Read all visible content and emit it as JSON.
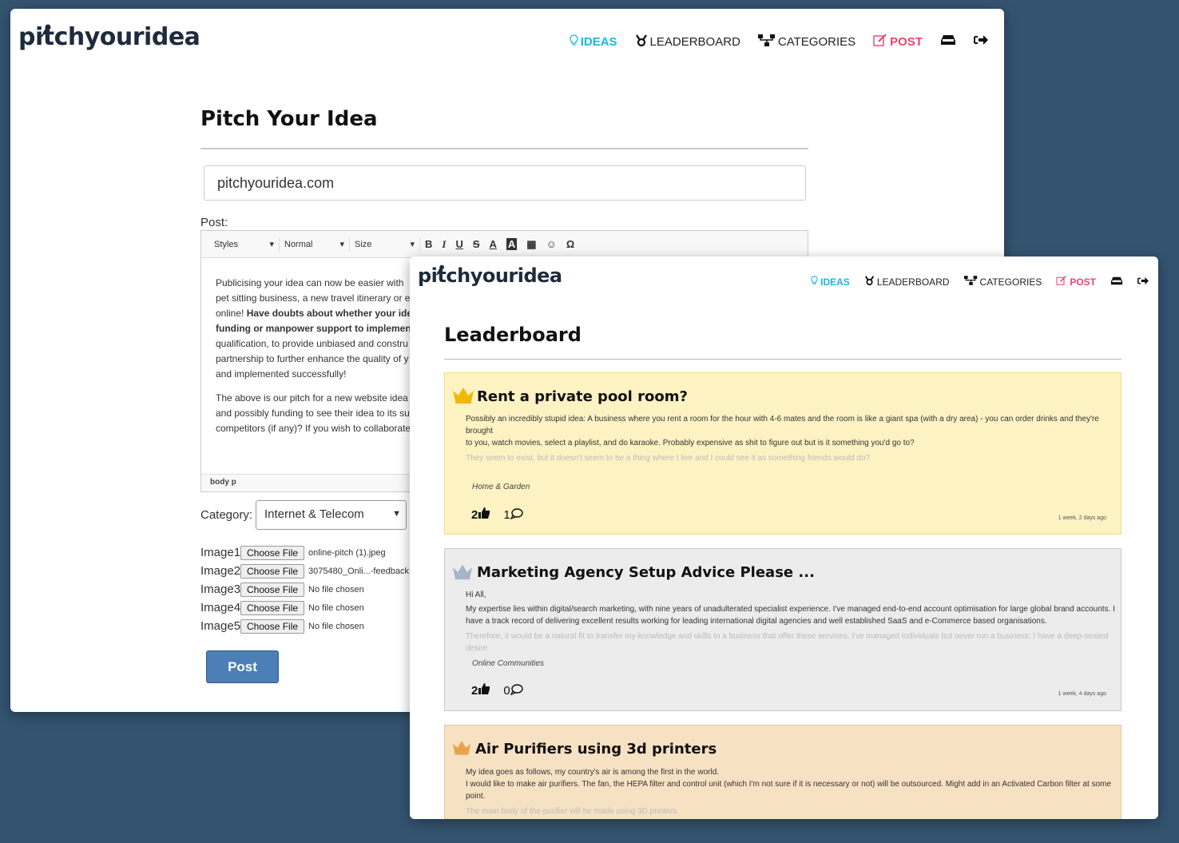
{
  "colors": {
    "background": "#34536f",
    "nav_ideas": "#19b6e6",
    "nav_post": "#e8466b",
    "button_blue": "#4b7fb5",
    "gold": "#f2b705",
    "silver": "#aab4c8",
    "bronze": "#e8a24a"
  },
  "logo_text": "pitchyouridea",
  "nav": {
    "ideas": "IDEAS",
    "leaderboard": "LEADERBOARD",
    "categories": "CATEGORIES",
    "post": "POST"
  },
  "icons": {
    "ideas": "lightbulb-icon",
    "leaderboard": "medal-icon",
    "categories": "sitemap-icon",
    "post": "edit-icon",
    "inbox": "inbox-icon",
    "logout": "sign-out-icon"
  },
  "pitch_form": {
    "title": "Pitch Your Idea",
    "title_value": "pitchyouridea.com",
    "post_label": "Post:",
    "toolbar": {
      "styles": "Styles",
      "format": "Normal",
      "size": "Size",
      "bold": "B",
      "italic": "I",
      "underline": "U",
      "strike": "S",
      "text_color": "A",
      "bg_color": "A",
      "table": "▦",
      "emoji": "☺",
      "special_char": "Ω"
    },
    "body_p1_a": "Publicising your idea can now be easier with ",
    "body_p1_b": "pet sitting business, a new travel itinerary or e",
    "body_p1_c": "online! ",
    "body_p1_bold": "Have doubts about whether your ide",
    "body_p1_bold2": "funding or manpower support to implemen",
    "body_p1_d": "qualification, to provide unbiased and constru",
    "body_p1_e": "partnership to further enhance the quality of y",
    "body_p1_f": "and implemented successfully!",
    "body_p2_a": "The above is our pitch for a new website idea",
    "body_p2_b": "and possibly funding to see their idea to its su",
    "body_p2_c": "competitors (if any)? If you wish to collaborate",
    "status_path": "body  p",
    "category_label": "Category:",
    "category_value": "Internet & Telecom",
    "images": [
      {
        "label": "Image1:",
        "button": "Choose File",
        "file": "online-pitch (1).jpeg"
      },
      {
        "label": "Image2:",
        "button": "Choose File",
        "file": "3075480_Onli...-feedback.jp"
      },
      {
        "label": "Image3:",
        "button": "Choose File",
        "file": "No file chosen"
      },
      {
        "label": "Image4:",
        "button": "Choose File",
        "file": "No file chosen"
      },
      {
        "label": "Image5:",
        "button": "Choose File",
        "file": "No file chosen"
      }
    ],
    "submit_label": "Post"
  },
  "leaderboard": {
    "title": "Leaderboard",
    "cards": [
      {
        "rank": "gold",
        "title": "Rent a private pool room?",
        "line1": "Possibly an incredibly stupid idea: A business where you rent a room for the hour with 4-6 mates and the room is like a giant spa (with a dry area) - you can order drinks and they're brought",
        "line2": "to you, watch movies, select a playlist, and do karaoke. Probably expensive as shit to figure out but is it something you'd go to?",
        "line3": "They seem to exist, but it doesn't seem to be a thing where I live and I could see it as something friends would do?",
        "category": "Home & Garden",
        "likes": "2",
        "comments": "1",
        "time": "1 week, 2 days ago"
      },
      {
        "rank": "silver",
        "title": "Marketing Agency Setup Advice Please ...",
        "line1": "Hi All,",
        "line2": "My expertise lies within digital/search marketing, with nine years of unadulterated specialist experience. I've managed end-to-end account optimisation for large global brand accounts. I",
        "line3": "have a track record of delivering excellent results working for leading international digital agencies and well established SaaS and e-Commerce based organisations.",
        "line4": "Therefore, it would be a natural fit to transfer my knowledge and skills to a business that offer these services. I've managed individuals but never run a business; I have a deep-seated desire",
        "category": "Online Communities",
        "likes": "2",
        "comments": "0",
        "time": "1 week, 4 days ago"
      },
      {
        "rank": "bronze",
        "title": "Air Purifiers using 3d printers",
        "line1": "My idea goes as follows, my country's air is among the first in the world.",
        "line2": "I would like to make air purifiers. The fan, the HEPA filter and control unit (which I'm not sure if it is necessary or not) will be outsourced. Might add in an Activated Carbon filter at some",
        "line3": "point.",
        "line4": "The main body of the purifier will be made using 3D printers."
      }
    ]
  }
}
